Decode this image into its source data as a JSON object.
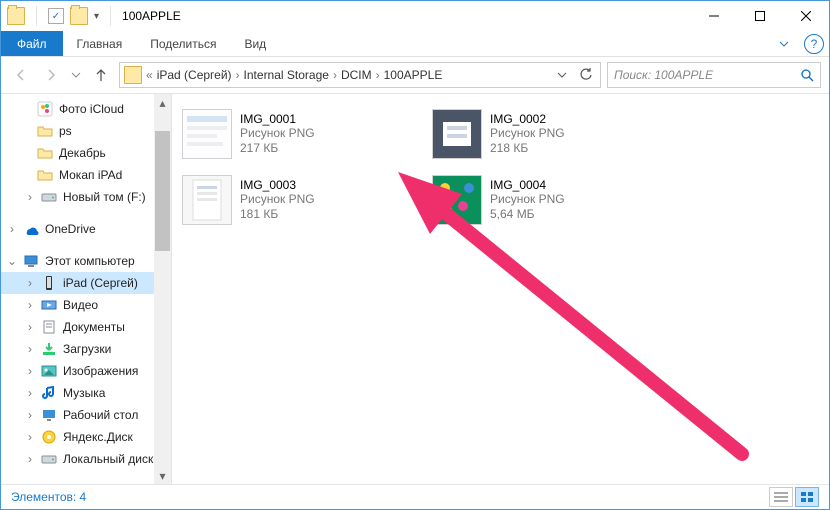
{
  "window": {
    "title": "100APPLE"
  },
  "quick_access": {
    "check_label": "✓",
    "props_label": "☰"
  },
  "ribbon": {
    "file": "Файл",
    "tabs": [
      "Главная",
      "Поделиться",
      "Вид"
    ]
  },
  "address": {
    "root_prefix": "«",
    "crumbs": [
      "iPad (Сергей)",
      "Internal Storage",
      "DCIM",
      "100APPLE"
    ]
  },
  "search": {
    "placeholder": "Поиск: 100APPLE"
  },
  "navpane": {
    "items": [
      {
        "icon": "icloud",
        "label": "Фото iCloud",
        "indent": 1
      },
      {
        "icon": "folder",
        "label": "ps",
        "indent": 1
      },
      {
        "icon": "folder-star",
        "label": "Декабрь",
        "indent": 1
      },
      {
        "icon": "folder",
        "label": "Мокап iPAd",
        "indent": 1
      },
      {
        "icon": "drive",
        "label": "Новый том (F:)",
        "indent": 1,
        "exp": ">"
      },
      {
        "gap": true
      },
      {
        "icon": "onedrive",
        "label": "OneDrive",
        "indent": 0,
        "exp": ">"
      },
      {
        "gap": true
      },
      {
        "icon": "thispc",
        "label": "Этот компьютер",
        "indent": 0,
        "exp": "v"
      },
      {
        "icon": "ipad",
        "label": "iPad (Сергей)",
        "indent": 1,
        "exp": ">",
        "selected": true
      },
      {
        "icon": "video",
        "label": "Видео",
        "indent": 1,
        "exp": ">"
      },
      {
        "icon": "docs",
        "label": "Документы",
        "indent": 1,
        "exp": ">"
      },
      {
        "icon": "downloads",
        "label": "Загрузки",
        "indent": 1,
        "exp": ">"
      },
      {
        "icon": "images",
        "label": "Изображения",
        "indent": 1,
        "exp": ">"
      },
      {
        "icon": "music",
        "label": "Музыка",
        "indent": 1,
        "exp": ">"
      },
      {
        "icon": "desktop",
        "label": "Рабочий стол",
        "indent": 1,
        "exp": ">"
      },
      {
        "icon": "yadisk",
        "label": "Яндекс.Диск",
        "indent": 1,
        "exp": ">"
      },
      {
        "icon": "drive-c",
        "label": "Локальный диск (",
        "indent": 1,
        "exp": ">"
      }
    ]
  },
  "files": [
    {
      "name": "IMG_0001",
      "type": "Рисунок PNG",
      "size": "217 КБ",
      "thumb": "light"
    },
    {
      "name": "IMG_0002",
      "type": "Рисунок PNG",
      "size": "218 КБ",
      "thumb": "shot-dark"
    },
    {
      "name": "IMG_0003",
      "type": "Рисунок PNG",
      "size": "181 КБ",
      "thumb": "doc-light"
    },
    {
      "name": "IMG_0004",
      "type": "Рисунок PNG",
      "size": "5,64 МБ",
      "thumb": "photo"
    }
  ],
  "status": {
    "count_label": "Элементов: 4"
  }
}
